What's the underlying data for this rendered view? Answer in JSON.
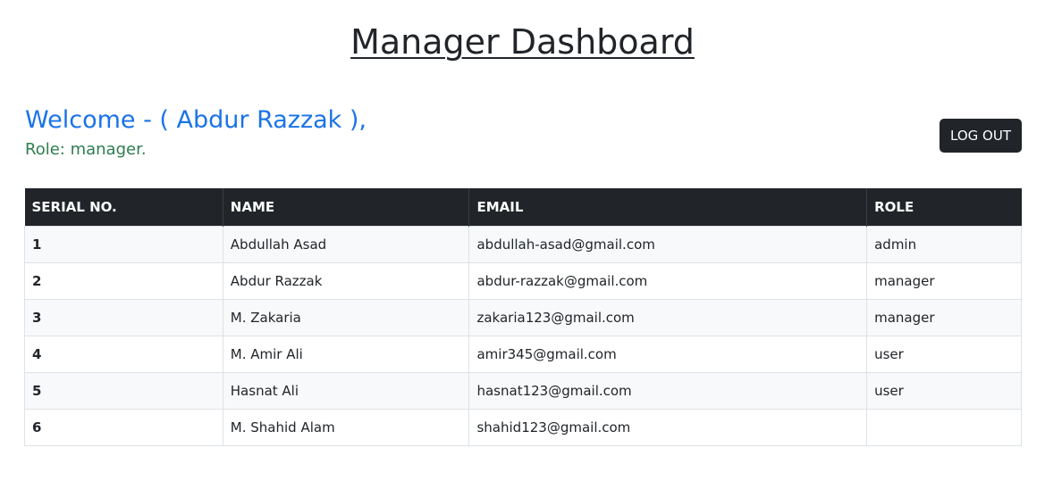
{
  "page": {
    "title": "Manager Dashboard"
  },
  "user": {
    "welcome": "Welcome - ( Abdur Razzak ),",
    "role_line": "Role: manager."
  },
  "actions": {
    "logout_label": "LOG OUT"
  },
  "table": {
    "headers": {
      "serial": "SERIAL NO.",
      "name": "NAME",
      "email": "EMAIL",
      "role": "ROLE"
    },
    "rows": [
      {
        "serial": "1",
        "name": "Abdullah Asad",
        "email": "abdullah-asad@gmail.com",
        "role": "admin"
      },
      {
        "serial": "2",
        "name": "Abdur Razzak",
        "email": "abdur-razzak@gmail.com",
        "role": "manager"
      },
      {
        "serial": "3",
        "name": "M. Zakaria",
        "email": "zakaria123@gmail.com",
        "role": "manager"
      },
      {
        "serial": "4",
        "name": "M. Amir Ali",
        "email": "amir345@gmail.com",
        "role": "user"
      },
      {
        "serial": "5",
        "name": "Hasnat Ali",
        "email": "hasnat123@gmail.com",
        "role": "user"
      },
      {
        "serial": "6",
        "name": "M. Shahid Alam",
        "email": "shahid123@gmail.com",
        "role": ""
      }
    ]
  },
  "colors": {
    "welcome": "#1a73e8",
    "role": "#2e7d4f",
    "header_bg": "#212529",
    "button_bg": "#212529"
  }
}
